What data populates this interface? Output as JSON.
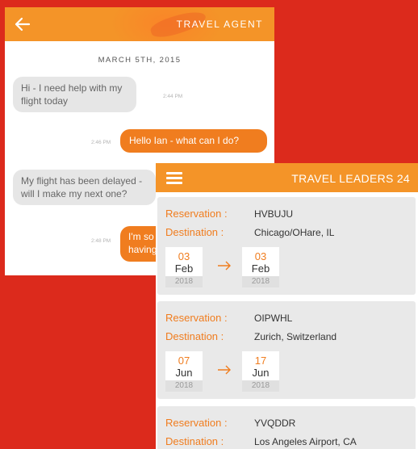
{
  "chat": {
    "title": "TRAVEL AGENT",
    "date": "MARCH 5TH, 2015",
    "messages": [
      {
        "dir": "in",
        "text": "Hi - I need help with my flight today",
        "time": "2:44 PM"
      },
      {
        "dir": "out",
        "text": "Hello Ian - what can I do?",
        "time": "2:46 PM"
      },
      {
        "dir": "in",
        "text": "My flight has been delayed - will I make my next one?",
        "time": ""
      },
      {
        "dir": "out",
        "text": "I'm so having",
        "time": "2:48 PM"
      }
    ]
  },
  "reservations": {
    "title": "TRAVEL LEADERS 24",
    "reservation_label": "Reservation :",
    "destination_label": "Destination :",
    "items": [
      {
        "code": "HVBUJU",
        "destination": "Chicago/OHare, IL",
        "from": {
          "day": "03",
          "month": "Feb",
          "year": "2018"
        },
        "to": {
          "day": "03",
          "month": "Feb",
          "year": "2018"
        }
      },
      {
        "code": "OIPWHL",
        "destination": "Zurich, Switzerland",
        "from": {
          "day": "07",
          "month": "Jun",
          "year": "2018"
        },
        "to": {
          "day": "17",
          "month": "Jun",
          "year": "2018"
        }
      },
      {
        "code": "YVQDDR",
        "destination": "Los Angeles Airport, CA"
      }
    ]
  },
  "colors": {
    "background": "#dc2a1c",
    "accent": "#f49428",
    "bubble_out": "#f07d1f",
    "bubble_in": "#e6e6e6"
  },
  "icons": {
    "back": "left-arrow-icon",
    "menu": "hamburger-menu-icon",
    "date_arrow": "right-arrow-icon"
  }
}
